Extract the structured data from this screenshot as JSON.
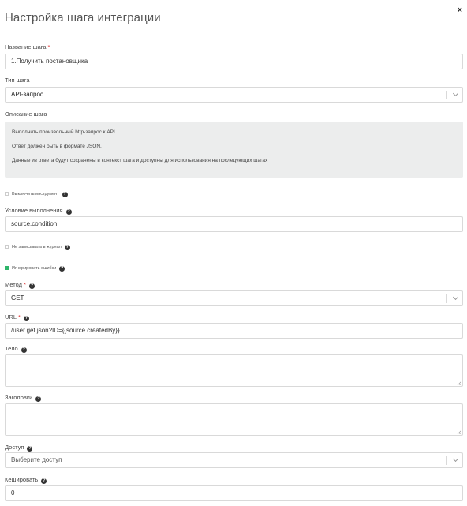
{
  "header": {
    "title": "Настройка шага интеграции",
    "close": "×"
  },
  "step_name": {
    "label": "Название шага",
    "required_mark": "*",
    "value": "1.Получить постановщика"
  },
  "step_type": {
    "label": "Тип шага",
    "value": "API-запрос"
  },
  "description": {
    "label": "Описание шага",
    "lines": [
      "Выполнить произвольный http-запрос к API.",
      "Ответ должен быть в формате JSON.",
      "Данные из ответа будут сохранены в контекст шага и доступны для использования на последующих шагах"
    ]
  },
  "disable_tool": {
    "label": "Выключить инструмент",
    "checked": false
  },
  "condition": {
    "label": "Условие выполнения",
    "value": "source.condition"
  },
  "no_log": {
    "label": "Не записывать в журнал",
    "checked": false
  },
  "ignore_errors": {
    "label": "Игнорировать ошибки",
    "checked": true
  },
  "method": {
    "label": "Метод",
    "required_mark": "*",
    "value": "GET"
  },
  "url": {
    "label": "URL",
    "required_mark": "*",
    "value": "/user.get.json?ID={{source.createdBy}}"
  },
  "body": {
    "label": "Тело",
    "value": ""
  },
  "headers": {
    "label": "Заголовки",
    "value": ""
  },
  "access": {
    "label": "Доступ",
    "placeholder": "Выберите доступ"
  },
  "cache": {
    "label": "Кешировать",
    "value": "0"
  },
  "icons": {
    "help": "?"
  },
  "colors": {
    "accent": "#2fb56a",
    "required": "#e03333"
  }
}
